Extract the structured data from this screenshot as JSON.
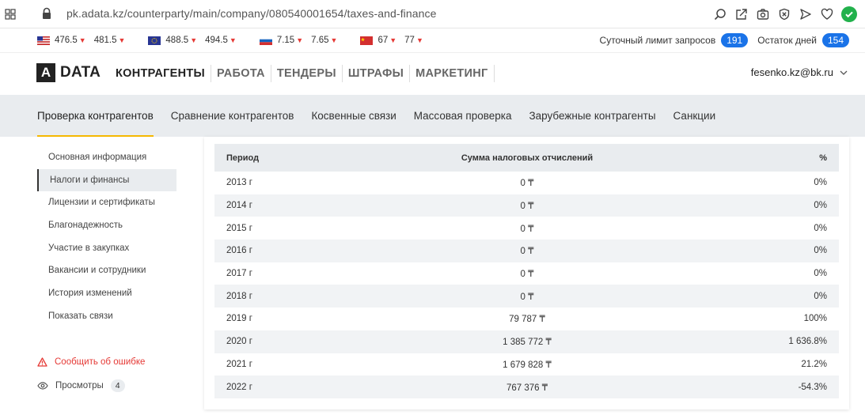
{
  "browser": {
    "url": "pk.adata.kz/counterparty/main/company/080540001654/taxes-and-finance",
    "icons": [
      "grid-icon",
      "lock-icon",
      "zoom-icon",
      "share-icon",
      "camera-icon",
      "shield-x-icon",
      "send-icon",
      "heart-icon",
      "check-circle-icon"
    ]
  },
  "rates": [
    {
      "flag": "us",
      "buy": "476.5",
      "sell": "481.5"
    },
    {
      "flag": "eu",
      "buy": "488.5",
      "sell": "494.5"
    },
    {
      "flag": "ru",
      "buy": "7.15",
      "sell": "7.65"
    },
    {
      "flag": "cn",
      "buy": "67",
      "sell": "77"
    }
  ],
  "limits": {
    "daily_label": "Суточный лимит запросов",
    "daily_value": "191",
    "days_label": "Остаток дней",
    "days_value": "154"
  },
  "logo": {
    "mark": "A",
    "text": "DATA"
  },
  "nav": [
    "КОНТРАГЕНТЫ",
    "РАБОТА",
    "ТЕНДЕРЫ",
    "ШТРАФЫ",
    "МАРКЕТИНГ"
  ],
  "user": {
    "email": "fesenko.kz@bk.ru"
  },
  "subnav": [
    "Проверка контрагентов",
    "Сравнение контрагентов",
    "Косвенные связи",
    "Массовая проверка",
    "Зарубежные контрагенты",
    "Санкции"
  ],
  "sidebar": {
    "items": [
      "Основная информация",
      "Налоги и финансы",
      "Лицензии и сертификаты",
      "Благонадежность",
      "Участие в закупках",
      "Вакансии и сотрудники",
      "История изменений",
      "Показать связи"
    ],
    "report": "Сообщить об ошибке",
    "views_label": "Просмотры",
    "views_count": "4"
  },
  "table": {
    "headers": [
      "Период",
      "Сумма налоговых отчислений",
      "%"
    ],
    "rows": [
      {
        "period": "2013 г",
        "amount": "0 ₸",
        "pct": "0%",
        "trend": "none"
      },
      {
        "period": "2014 г",
        "amount": "0 ₸",
        "pct": "0%",
        "trend": "none"
      },
      {
        "period": "2015 г",
        "amount": "0 ₸",
        "pct": "0%",
        "trend": "none"
      },
      {
        "period": "2016 г",
        "amount": "0 ₸",
        "pct": "0%",
        "trend": "none"
      },
      {
        "period": "2017 г",
        "amount": "0 ₸",
        "pct": "0%",
        "trend": "none"
      },
      {
        "period": "2018 г",
        "amount": "0 ₸",
        "pct": "0%",
        "trend": "none"
      },
      {
        "period": "2019 г",
        "amount": "79 787 ₸",
        "pct": "100%",
        "trend": "pos"
      },
      {
        "period": "2020 г",
        "amount": "1 385 772 ₸",
        "pct": "1 636.8%",
        "trend": "pos"
      },
      {
        "period": "2021 г",
        "amount": "1 679 828 ₸",
        "pct": "21.2%",
        "trend": "pos"
      },
      {
        "period": "2022 г",
        "amount": "767 376 ₸",
        "pct": "-54.3%",
        "trend": "neg"
      }
    ]
  },
  "colors": {
    "accent_yellow": "#f5b800",
    "badge_blue": "#1a73e8",
    "positive": "#3aa655",
    "negative": "#e53935"
  }
}
